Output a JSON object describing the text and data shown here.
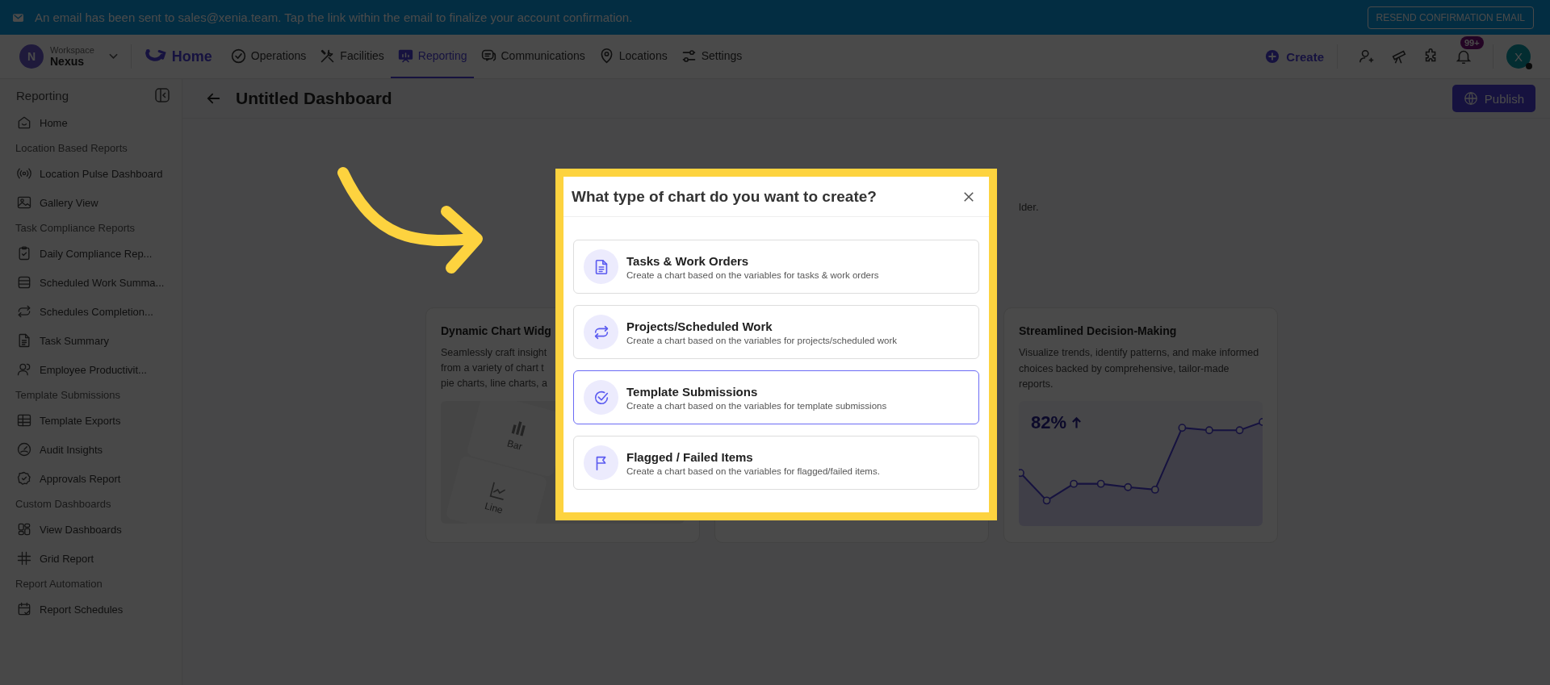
{
  "banner": {
    "message": "An email has been sent to sales@xenia.team. Tap the link within the email to finalize your account confirmation.",
    "button": "RESEND CONFIRMATION EMAIL"
  },
  "nav": {
    "workspace_label": "Workspace",
    "workspace_name": "Nexus",
    "workspace_initial": "N",
    "home": "Home",
    "create": "Create",
    "notification_count": "99+",
    "user_initial": "X",
    "tabs": [
      {
        "label": "Operations",
        "selected": false
      },
      {
        "label": "Facilities",
        "selected": false
      },
      {
        "label": "Reporting",
        "selected": true
      },
      {
        "label": "Communications",
        "selected": false
      },
      {
        "label": "Locations",
        "selected": false
      },
      {
        "label": "Settings",
        "selected": false
      }
    ]
  },
  "sidebar": {
    "title": "Reporting",
    "groups": [
      {
        "items": [
          "Home"
        ]
      },
      {
        "heading": "Location Based Reports",
        "items": [
          "Location Pulse Dashboard",
          "Gallery View"
        ]
      },
      {
        "heading": "Task Compliance Reports",
        "items": [
          "Daily Compliance Rep...",
          "Scheduled Work Summa...",
          "Schedules Completion...",
          "Task Summary",
          "Employee Productivit..."
        ]
      },
      {
        "heading": "Template Submissions",
        "items": [
          "Template Exports",
          "Audit Insights",
          "Approvals Report"
        ]
      },
      {
        "heading": "Custom Dashboards",
        "items": [
          "View Dashboards",
          "Grid Report"
        ]
      },
      {
        "heading": "Report Automation",
        "items": [
          "Report Schedules"
        ]
      }
    ]
  },
  "header": {
    "title": "Untitled Dashboard",
    "publish": "Publish",
    "subtitle_fragment": "lder."
  },
  "cards": [
    {
      "kind": "chart-types",
      "title": "Dynamic Chart Widg",
      "lines": [
        "Seamlessly craft insight",
        "from a variety of chart t",
        "pie charts, line charts, a"
      ],
      "tiles": [
        "Bar",
        "Line"
      ]
    },
    {
      "kind": "hidden"
    },
    {
      "kind": "trend",
      "title": "Streamlined Decision-Making",
      "description": "Visualize trends, identify patterns, and make informed choices backed by comprehensive, tailor-made reports.",
      "stat": "82%"
    }
  ],
  "modal": {
    "title": "What type of chart do you want to create?",
    "options": [
      {
        "title": "Tasks & Work Orders",
        "description": "Create a chart based on the variables for tasks & work orders",
        "selected": false
      },
      {
        "title": "Projects/Scheduled Work",
        "description": "Create a chart based on the variables for projects/scheduled work",
        "selected": false
      },
      {
        "title": "Template Submissions",
        "description": "Create a chart based on the variables for template submissions",
        "selected": true
      },
      {
        "title": "Flagged / Failed Items",
        "description": "Create a chart based on the variables for flagged/failed items.",
        "selected": false
      }
    ]
  }
}
